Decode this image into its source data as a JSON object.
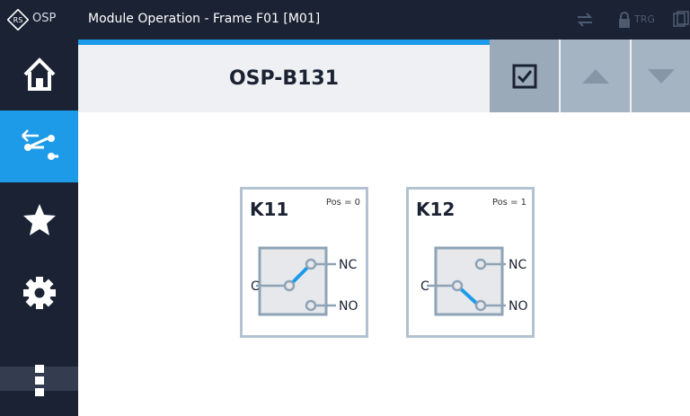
{
  "app": {
    "brand": "OSP",
    "title": "Module Operation - Frame F01 [M01]",
    "trg_label": "TRG"
  },
  "sidebar": {
    "items": [
      {
        "name": "home",
        "icon": "home-icon",
        "active": false
      },
      {
        "name": "switch-operation",
        "icon": "switch-operation-icon",
        "active": true
      },
      {
        "name": "favorites",
        "icon": "star-icon",
        "active": false
      },
      {
        "name": "settings",
        "icon": "gear-icon",
        "active": false
      },
      {
        "name": "more",
        "icon": "kebab-menu-icon",
        "active": false
      }
    ]
  },
  "header": {
    "module_name": "OSP-B131",
    "buttons": [
      {
        "name": "confirm",
        "icon": "checkbox-checked-icon"
      },
      {
        "name": "up",
        "icon": "arrow-up-icon"
      },
      {
        "name": "down",
        "icon": "arrow-down-icon"
      }
    ]
  },
  "relays": [
    {
      "name": "K11",
      "pos_label": "Pos = 0",
      "port_common": "C",
      "port_nc": "NC",
      "port_no": "NO",
      "connected": "NC"
    },
    {
      "name": "K12",
      "pos_label": "Pos = 1",
      "port_common": "C",
      "port_nc": "NC",
      "port_no": "NO",
      "connected": "NO"
    }
  ],
  "colors": {
    "accent": "#1e9be8",
    "dark": "#1a2233",
    "switch_body": "#e6e8eb",
    "switch_frame": "#8fa3b6"
  }
}
